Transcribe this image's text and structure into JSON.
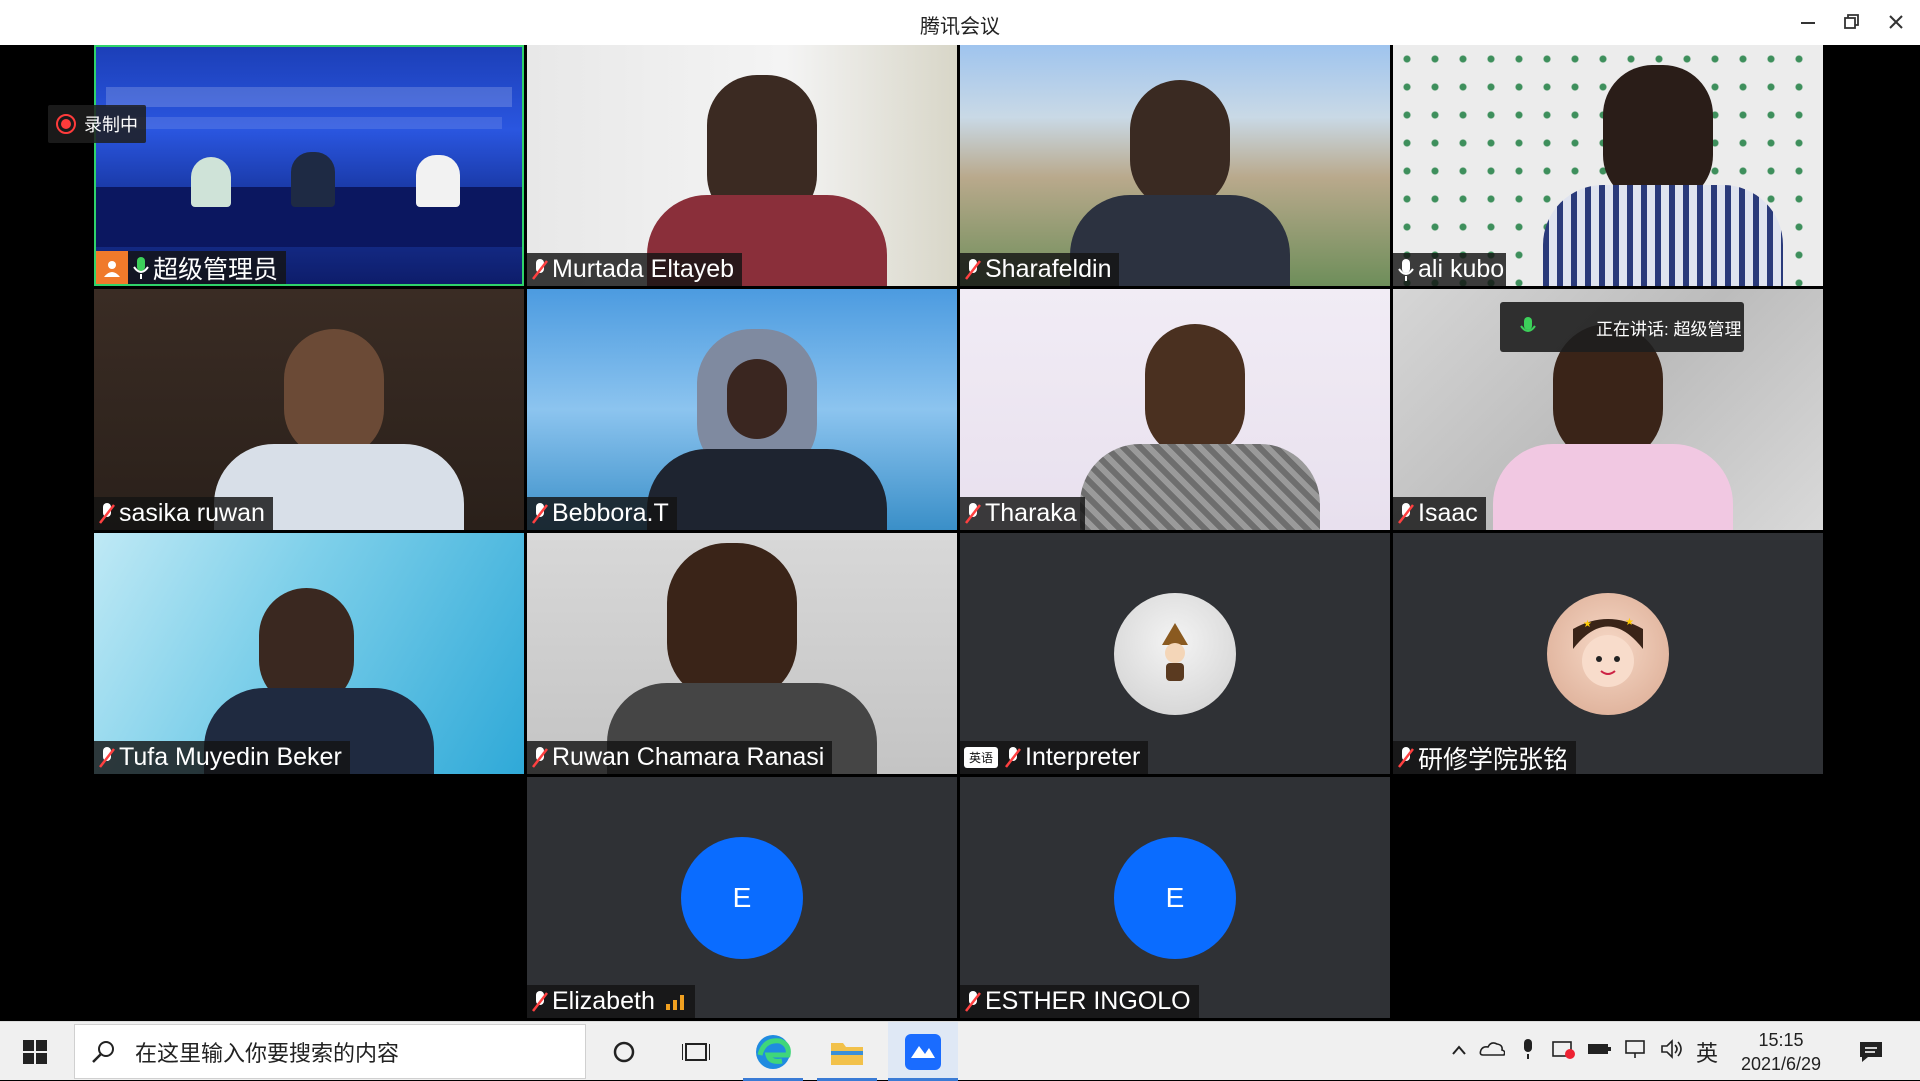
{
  "window": {
    "title": "腾讯会议"
  },
  "recording": {
    "label": "录制中"
  },
  "speaking": {
    "label": "正在讲话: 超级管理"
  },
  "participants": [
    {
      "name": "超级管理员"
    },
    {
      "name": "Murtada Eltayeb"
    },
    {
      "name": "Sharafeldin"
    },
    {
      "name": "ali kubo"
    },
    {
      "name": "sasika ruwan"
    },
    {
      "name": "Bebbora.T"
    },
    {
      "name": "Tharaka"
    },
    {
      "name": "Isaac"
    },
    {
      "name": "Tufa Muyedin Beker"
    },
    {
      "name": "Ruwan Chamara Ranasi"
    },
    {
      "name": "Interpreter",
      "lang_badge": "英语"
    },
    {
      "name": "研修学院张铭"
    },
    {
      "name": "Elizabeth",
      "avatar_letter": "E"
    },
    {
      "name": "ESTHER INGOLO",
      "avatar_letter": "E"
    }
  ],
  "taskbar": {
    "search_placeholder": "在这里输入你要搜索的内容",
    "ime": "英",
    "time": "15:15",
    "date": "2021/6/29"
  },
  "colors": {
    "avatar_blue": "#0a6cff",
    "host_badge": "#f07a2b",
    "mic_on": "#3cd05a",
    "rec_red": "#ff3b3b"
  }
}
